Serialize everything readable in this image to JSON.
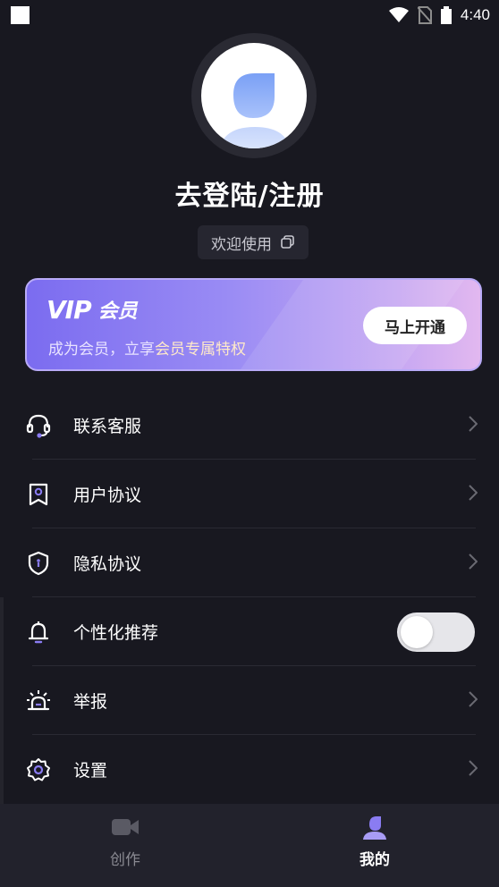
{
  "status_bar": {
    "time": "4:40"
  },
  "profile": {
    "login_title": "去登陆/注册",
    "welcome_text": "欢迎使用"
  },
  "vip": {
    "logo_vip": "VIP",
    "logo_member": "会员",
    "desc_prefix": "成为会员，立享",
    "desc_highlight": "会员专属特权",
    "button_label": "马上开通"
  },
  "menu": {
    "items": [
      {
        "label": "联系客服",
        "icon": "headset-icon"
      },
      {
        "label": "用户协议",
        "icon": "bookmark-doc-icon"
      },
      {
        "label": "隐私协议",
        "icon": "shield-icon"
      },
      {
        "label": "个性化推荐",
        "icon": "bell-icon",
        "toggle_on": false
      },
      {
        "label": "举报",
        "icon": "alarm-icon"
      },
      {
        "label": "设置",
        "icon": "gear-icon"
      }
    ]
  },
  "bottom_nav": {
    "tabs": [
      {
        "label": "创作",
        "icon": "video-camera-icon",
        "active": false
      },
      {
        "label": "我的",
        "icon": "user-icon",
        "active": true
      }
    ]
  },
  "colors": {
    "background": "#181820",
    "accent": "#7b6cf0",
    "chip": "#262630",
    "nav_bg": "#22222c"
  }
}
